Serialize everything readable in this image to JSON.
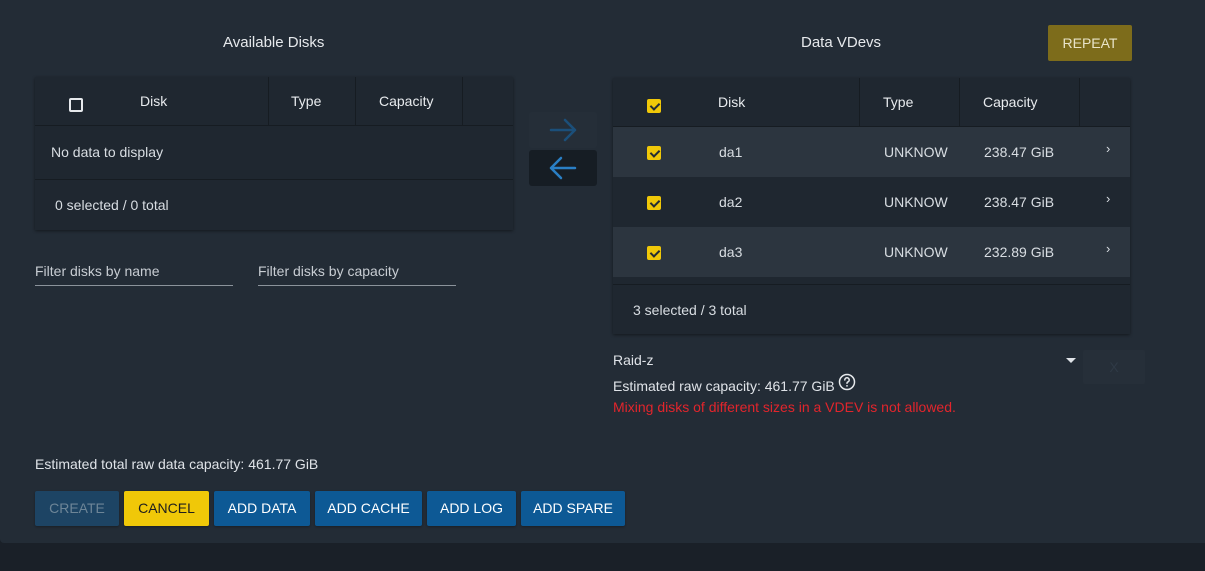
{
  "available": {
    "title": "Available Disks",
    "columns": {
      "disk": "Disk",
      "type": "Type",
      "capacity": "Capacity"
    },
    "empty_text": "No data to display",
    "footer": "0 selected / 0 total"
  },
  "filters": {
    "name_placeholder": "Filter disks by name",
    "capacity_placeholder": "Filter disks by capacity"
  },
  "vdevs": {
    "title": "Data VDevs",
    "repeat_label": "REPEAT",
    "columns": {
      "disk": "Disk",
      "type": "Type",
      "capacity": "Capacity"
    },
    "rows": [
      {
        "disk": "da1",
        "type": "UNKNOW",
        "capacity": "238.47 GiB"
      },
      {
        "disk": "da2",
        "type": "UNKNOW",
        "capacity": "238.47 GiB"
      },
      {
        "disk": "da3",
        "type": "UNKNOW",
        "capacity": "232.89 GiB"
      }
    ],
    "footer": "3 selected / 3 total",
    "layout_value": "Raid-z",
    "estimated": "Estimated raw capacity: 461.77 GiB",
    "error": "Mixing disks of different sizes in a VDEV is not allowed.",
    "remove_label": "X"
  },
  "total_estimate": "Estimated total raw data capacity: 461.77 GiB",
  "buttons": {
    "create": "CREATE",
    "cancel": "CANCEL",
    "add_data": "ADD DATA",
    "add_cache": "ADD CACHE",
    "add_log": "ADD LOG",
    "add_spare": "ADD SPARE"
  },
  "colors": {
    "accent": "#f0c808",
    "primary": "#0d5995",
    "error": "#e2252c"
  }
}
